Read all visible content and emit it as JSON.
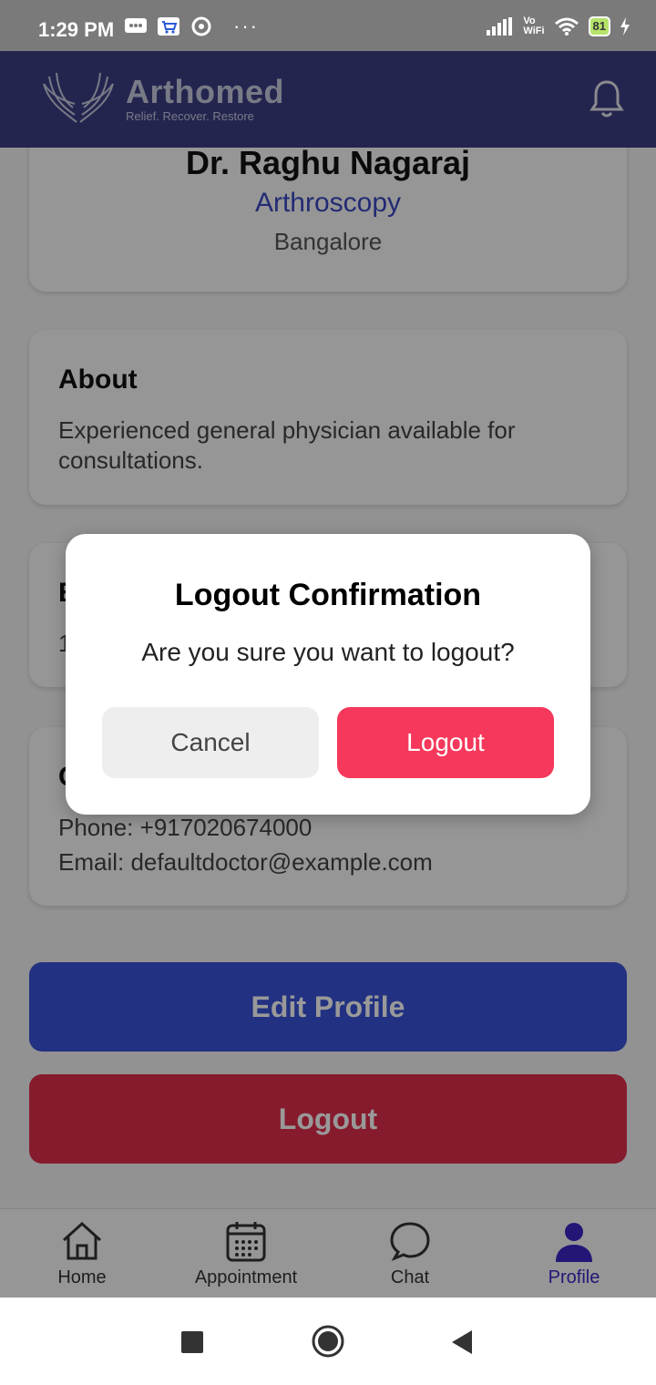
{
  "status_bar": {
    "time": "1:29 PM",
    "dots": "···",
    "vowifi_top": "Vo",
    "vowifi_bottom": "WiFi",
    "battery": "81"
  },
  "header": {
    "brand_name": "Arthomed",
    "brand_tagline": "Relief. Recover. Restore"
  },
  "profile": {
    "name": "Dr. Raghu Nagaraj",
    "specialty": "Arthroscopy",
    "city": "Bangalore"
  },
  "about": {
    "title": "About",
    "text": "Experienced general physician available for consultations."
  },
  "hidden_card": {
    "title_initial": "E",
    "text_initial": "1"
  },
  "contact": {
    "title_initial": "C",
    "phone": "Phone: +917020674000",
    "email": "Email: defaultdoctor@example.com"
  },
  "actions": {
    "edit_label": "Edit Profile",
    "logout_label": "Logout"
  },
  "bottom_nav": {
    "items": [
      {
        "label": "Home"
      },
      {
        "label": "Appointment"
      },
      {
        "label": "Chat"
      },
      {
        "label": "Profile"
      }
    ]
  },
  "dialog": {
    "title": "Logout Confirmation",
    "message": "Are you sure you want to logout?",
    "cancel_label": "Cancel",
    "confirm_label": "Logout"
  },
  "colors": {
    "header": "#3c3f84",
    "primary": "#3a52d8",
    "danger": "#e02d4c",
    "dialog_confirm": "#f5385b",
    "active_nav": "#3a27c6"
  }
}
